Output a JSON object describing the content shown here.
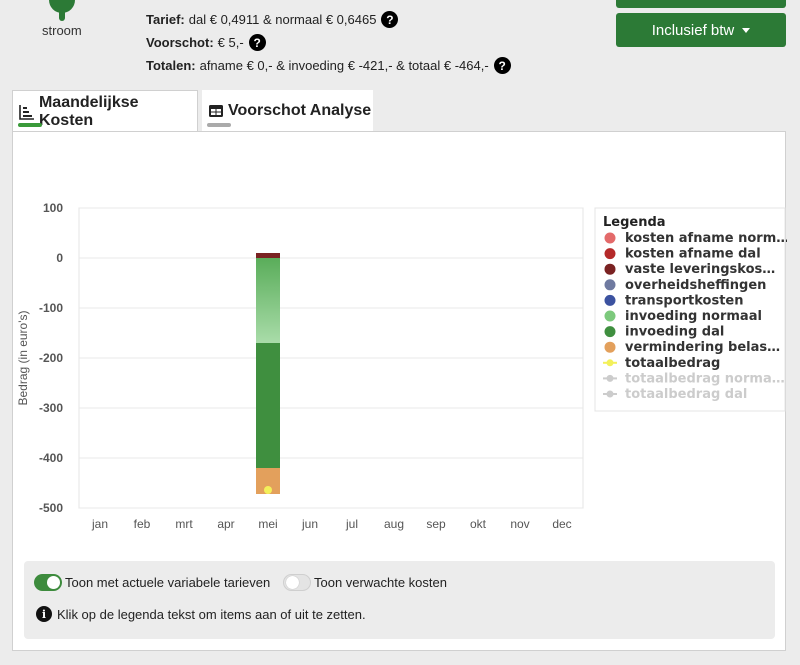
{
  "header": {
    "stroom_label": "stroom",
    "tarief_label": "Tarief:",
    "tarief_value": "dal € 0,4911 & normaal € 0,6465",
    "voorschot_label": "Voorschot:",
    "voorschot_value": "€ 5,-",
    "totalen_label": "Totalen:",
    "totalen_value": "afname € 0,- & invoeding € -421,- & totaal € -464,-",
    "help_glyph": "?",
    "btw_button_label": "Inclusief btw",
    "accent_color": "#2c7a36"
  },
  "tabs": [
    {
      "label": "Maandelijkse Kosten",
      "active": true,
      "underline_color": "#3a9a3a"
    },
    {
      "label": "Voorschot Analyse",
      "active": false,
      "underline_color": "#aaaaaa"
    }
  ],
  "chart_data": {
    "type": "bar",
    "stacked": true,
    "ylabel": "Bedrag (in euro's)",
    "ylim": [
      -500,
      100
    ],
    "yticks": [
      100,
      0,
      -100,
      -200,
      -300,
      -400,
      -500
    ],
    "categories": [
      "jan",
      "feb",
      "mrt",
      "apr",
      "mei",
      "jun",
      "jul",
      "aug",
      "sep",
      "okt",
      "nov",
      "dec"
    ],
    "series": [
      {
        "name": "kosten afname normaal",
        "color": "#e36a6a",
        "values": [
          0,
          0,
          0,
          0,
          0,
          0,
          0,
          0,
          0,
          0,
          0,
          0
        ]
      },
      {
        "name": "kosten afname dal",
        "color": "#b52a2a",
        "values": [
          0,
          0,
          0,
          0,
          0,
          0,
          0,
          0,
          0,
          0,
          0,
          0
        ]
      },
      {
        "name": "vaste leveringskosten",
        "color": "#7a2222",
        "values": [
          0,
          0,
          0,
          0,
          10,
          0,
          0,
          0,
          0,
          0,
          0,
          0
        ]
      },
      {
        "name": "overheidsheffingen",
        "color": "#6f7aa0",
        "values": [
          0,
          0,
          0,
          0,
          0,
          0,
          0,
          0,
          0,
          0,
          0,
          0
        ]
      },
      {
        "name": "transportkosten",
        "color": "#3c52a0",
        "values": [
          0,
          0,
          0,
          0,
          0,
          0,
          0,
          0,
          0,
          0,
          0,
          0
        ]
      },
      {
        "name": "invoeding normaal",
        "color": "#7cc97c",
        "values": [
          0,
          0,
          0,
          0,
          -170,
          0,
          0,
          0,
          0,
          0,
          0,
          0
        ]
      },
      {
        "name": "invoeding dal",
        "color": "#3f8f3f",
        "values": [
          0,
          0,
          0,
          0,
          -250,
          0,
          0,
          0,
          0,
          0,
          0,
          0
        ]
      },
      {
        "name": "vermindering belasting",
        "color": "#e3a05c",
        "values": [
          0,
          0,
          0,
          0,
          -52,
          0,
          0,
          0,
          0,
          0,
          0,
          0
        ]
      }
    ],
    "lines": [
      {
        "name": "totaalbedrag",
        "color": "#f3f05a",
        "values": [
          null,
          null,
          null,
          null,
          -464,
          null,
          null,
          null,
          null,
          null,
          null,
          null
        ],
        "enabled": true
      },
      {
        "name": "totaalbedrag normaal",
        "color": "#cccccc",
        "values": [],
        "enabled": false
      },
      {
        "name": "totaalbedrag dal",
        "color": "#cccccc",
        "values": [],
        "enabled": false
      }
    ],
    "legend_title": "Legenda",
    "legend_position": "right",
    "grid": true
  },
  "controls": {
    "toggle1_label": "Toon met actuele variabele tarieven",
    "toggle1_on": true,
    "toggle2_label": "Toon verwachte kosten",
    "toggle2_on": false,
    "info_glyph": "i",
    "info_text": "Klik op de legenda tekst om items aan of uit te zetten."
  }
}
